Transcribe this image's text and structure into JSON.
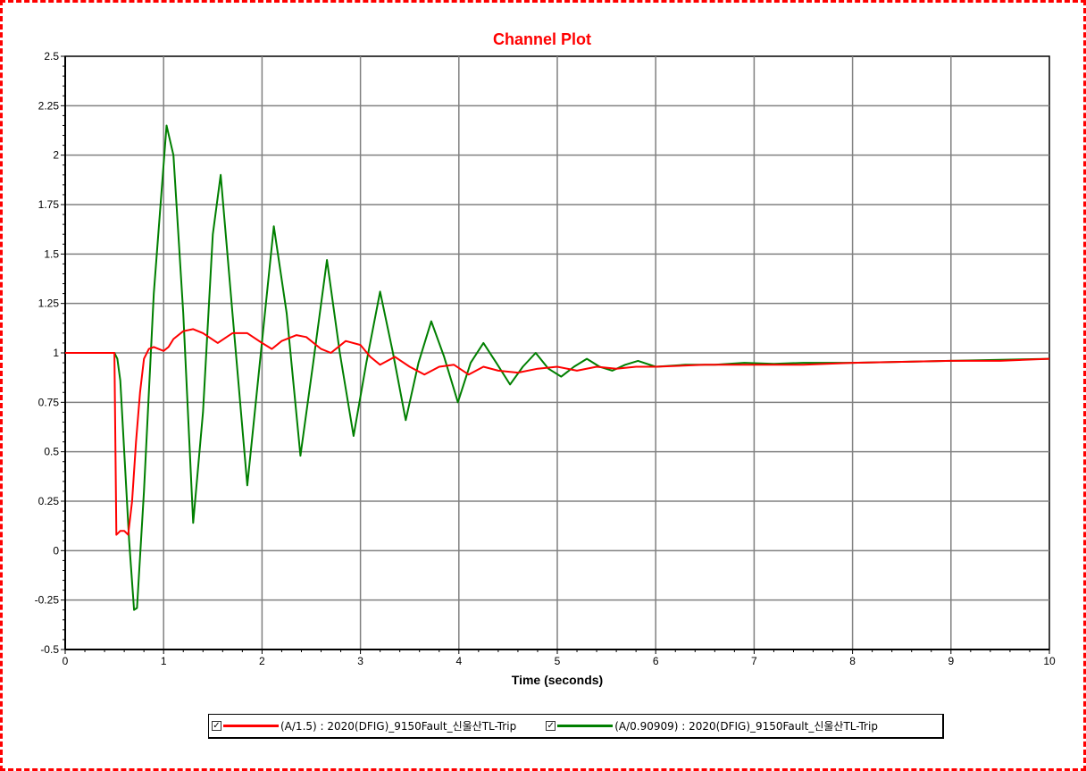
{
  "chart_data": {
    "type": "line",
    "title": "Channel Plot",
    "xlabel": "Time (seconds)",
    "ylabel": "",
    "xlim": [
      0,
      10
    ],
    "ylim": [
      -0.5,
      2.5
    ],
    "x_ticks": [
      "0",
      "1",
      "2",
      "3",
      "4",
      "5",
      "6",
      "7",
      "8",
      "9",
      "10"
    ],
    "y_ticks": [
      "2.5",
      "2.25",
      "2",
      "1.75",
      "1.5",
      "1.25",
      "1",
      "0.75",
      "0.5",
      "0.25",
      "0",
      "-0.25",
      "-0.5"
    ],
    "grid": true,
    "legend_position": "bottom",
    "series": [
      {
        "name": "(A/1.5) : 2020(DFIG)_9150Fault_신울산TL-Trip",
        "color": "#ff0000",
        "x": [
          0,
          0.5,
          0.52,
          0.54,
          0.56,
          0.6,
          0.64,
          0.68,
          0.72,
          0.76,
          0.8,
          0.85,
          0.9,
          1.0,
          1.05,
          1.1,
          1.2,
          1.3,
          1.4,
          1.55,
          1.7,
          1.85,
          2.0,
          2.1,
          2.2,
          2.35,
          2.45,
          2.6,
          2.7,
          2.85,
          3.0,
          3.1,
          3.2,
          3.35,
          3.5,
          3.65,
          3.8,
          3.95,
          4.1,
          4.25,
          4.4,
          4.6,
          4.8,
          5.0,
          5.2,
          5.4,
          5.6,
          5.8,
          6.0,
          6.5,
          7.0,
          7.5,
          8.0,
          8.5,
          9.0,
          9.5,
          10.0
        ],
        "y": [
          1.0,
          1.0,
          0.08,
          0.09,
          0.1,
          0.1,
          0.08,
          0.25,
          0.55,
          0.8,
          0.97,
          1.02,
          1.03,
          1.01,
          1.03,
          1.07,
          1.11,
          1.12,
          1.1,
          1.05,
          1.1,
          1.1,
          1.05,
          1.02,
          1.06,
          1.09,
          1.08,
          1.02,
          1.0,
          1.06,
          1.04,
          0.98,
          0.94,
          0.98,
          0.93,
          0.89,
          0.93,
          0.94,
          0.89,
          0.93,
          0.91,
          0.9,
          0.92,
          0.93,
          0.91,
          0.93,
          0.92,
          0.93,
          0.93,
          0.94,
          0.94,
          0.94,
          0.95,
          0.955,
          0.96,
          0.96,
          0.97
        ]
      },
      {
        "name": "(A/0.90909) : 2020(DFIG)_9150Fault_신울산TL-Trip",
        "color": "#007f00",
        "x": [
          0,
          0.5,
          0.53,
          0.56,
          0.6,
          0.65,
          0.7,
          0.73,
          0.8,
          0.9,
          1.03,
          1.1,
          1.2,
          1.3,
          1.4,
          1.5,
          1.58,
          1.7,
          1.85,
          2.12,
          2.25,
          2.39,
          2.52,
          2.66,
          2.79,
          2.93,
          3.06,
          3.2,
          3.33,
          3.46,
          3.59,
          3.72,
          3.85,
          3.99,
          4.12,
          4.25,
          4.38,
          4.52,
          4.65,
          4.78,
          4.91,
          5.04,
          5.17,
          5.3,
          5.43,
          5.56,
          5.69,
          5.82,
          6.0,
          6.3,
          6.6,
          6.9,
          7.2,
          7.5,
          8.0,
          8.5,
          9.0,
          9.5,
          10.0
        ],
        "y": [
          1.0,
          1.0,
          0.97,
          0.86,
          0.5,
          0.05,
          -0.3,
          -0.29,
          0.3,
          1.3,
          2.15,
          2.0,
          1.2,
          0.14,
          0.7,
          1.6,
          1.9,
          1.2,
          0.33,
          1.64,
          1.2,
          0.48,
          0.95,
          1.47,
          1.0,
          0.58,
          0.95,
          1.31,
          1.0,
          0.66,
          0.95,
          1.16,
          0.98,
          0.75,
          0.95,
          1.05,
          0.95,
          0.84,
          0.93,
          1.0,
          0.92,
          0.88,
          0.93,
          0.97,
          0.93,
          0.91,
          0.94,
          0.96,
          0.93,
          0.94,
          0.94,
          0.95,
          0.945,
          0.95,
          0.95,
          0.955,
          0.96,
          0.965,
          0.97
        ]
      }
    ]
  },
  "legend": {
    "check_mark": "✓"
  }
}
